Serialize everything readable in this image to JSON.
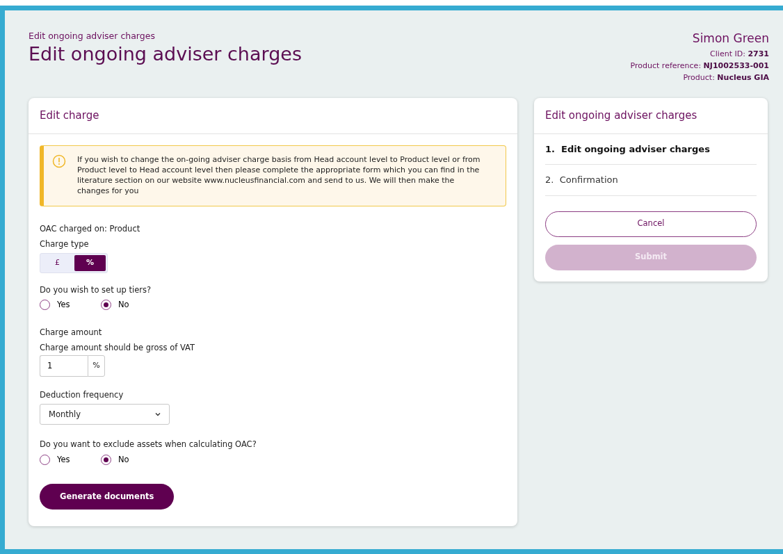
{
  "header": {
    "breadcrumb": "Edit ongoing adviser charges",
    "title": "Edit ongoing adviser charges"
  },
  "client": {
    "name": "Simon Green",
    "details": [
      "Client ID: **2731**",
      "Product reference: **NJ1002533-001**",
      "Product: **Nucleus GIA**"
    ]
  },
  "edit_card": {
    "title": "Edit charge",
    "alert": {
      "kind": "warning",
      "text": "If you wish to change the on-going adviser charge basis from Head account level to Product level or from Product level to Head account level then please complete the appropriate form which you can find in the literature section on our website www.nucleusfinancial.com and send to us. We will then make the changes for you"
    },
    "oac_charged_on": "OAC charged on: Product",
    "charge_type": {
      "label": "Charge type",
      "options": [
        {
          "label": "£",
          "selected": false
        },
        {
          "label": "%",
          "selected": true
        }
      ]
    },
    "tiers": {
      "label": "Do you wish to set up tiers?",
      "options": [
        {
          "label": "Yes",
          "selected": false
        },
        {
          "label": "No",
          "selected": true
        }
      ]
    },
    "charge_amount": {
      "label": "Charge amount",
      "hint": "Charge amount should be gross of VAT",
      "value": "1",
      "unit": "%"
    },
    "deduction_frequency": {
      "label": "Deduction frequency",
      "value": "Monthly"
    },
    "exclude_assets": {
      "label": "Do you want to exclude assets when calculating OAC?",
      "options": [
        {
          "label": "Yes",
          "selected": false
        },
        {
          "label": "No",
          "selected": true
        }
      ]
    },
    "generate_button": "Generate documents"
  },
  "steps_card": {
    "title": "Edit ongoing adviser charges",
    "steps": [
      {
        "number": "1.",
        "label": "Edit ongoing adviser charges",
        "selected": true
      },
      {
        "number": "2.",
        "label": "Confirmation",
        "selected": false
      }
    ],
    "cancel_button": "Cancel",
    "submit_button": {
      "label": "Submit",
      "disabled": true
    }
  }
}
